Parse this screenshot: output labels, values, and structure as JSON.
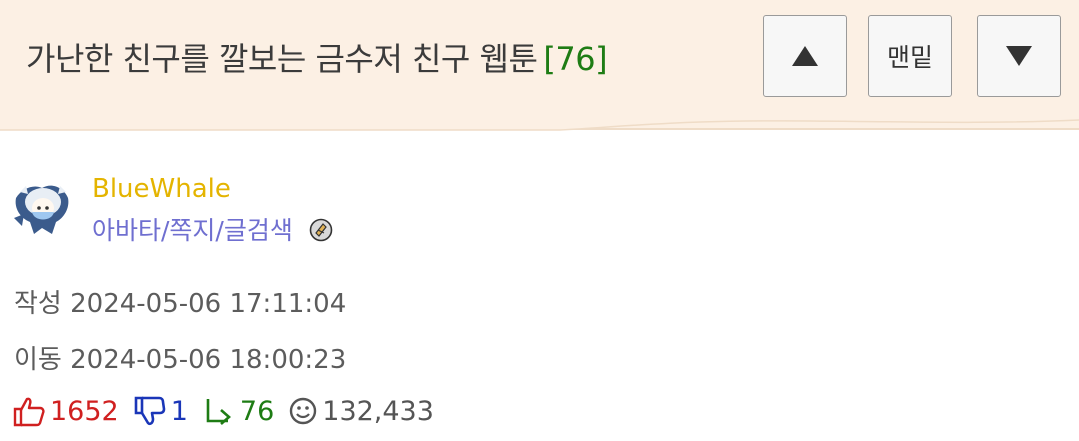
{
  "header": {
    "title": "가난한 친구를 깔보는 금수저 친구 웹툰",
    "comment_count": "[76]",
    "buttons": {
      "up_label": "▲",
      "bottom_label": "맨밑",
      "down_label": "▼"
    }
  },
  "author": {
    "username": "BlueWhale",
    "links": "아바타/쪽지/글검색",
    "avatar_icon": "whale-hood-avatar-icon",
    "badge_icon": "level-badge-icon"
  },
  "meta": {
    "created": "작성 2024-05-06 17:11:04",
    "moved": "이동 2024-05-06 18:00:23"
  },
  "stats": {
    "upvotes": "1652",
    "downvotes": "1",
    "replies": "76",
    "views": "132,433"
  },
  "colors": {
    "header_bg": "#fcf0e4",
    "username": "#e4b400",
    "link": "#6f6fd0",
    "upvote": "#d02020",
    "downvote": "#1a36b8",
    "reply": "#1e7c14"
  }
}
